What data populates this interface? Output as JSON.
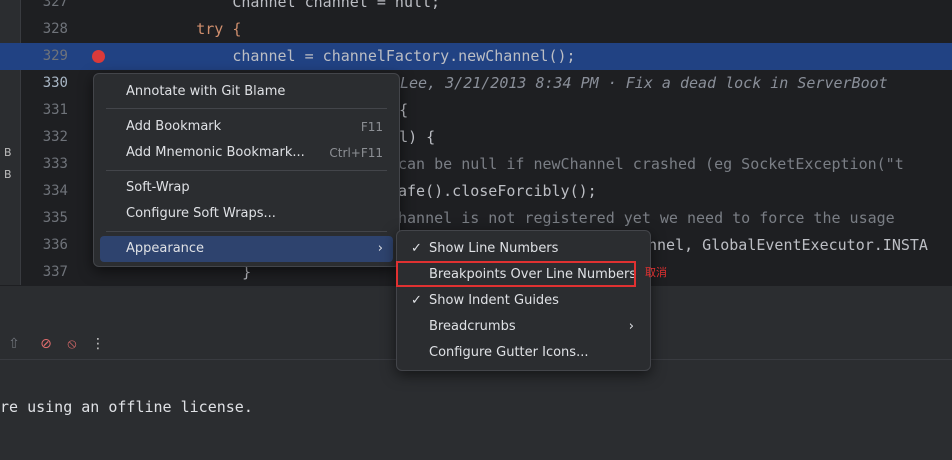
{
  "editor": {
    "lines": [
      {
        "num": "327",
        "code": "            Channel channel = null;"
      },
      {
        "num": "328",
        "code": "        try {"
      },
      {
        "num": "329",
        "code": "            channel = channelFactory.newChannel();"
      },
      {
        "num": "330",
        "code": ""
      },
      {
        "num": "331",
        "code": "t) {"
      },
      {
        "num": "332",
        "code": "null) {"
      },
      {
        "num": "333",
        "code": "can be null if newChannel crashed (eg SocketException(\"t"
      },
      {
        "num": "334",
        "code": "afe().closeForcibly();"
      },
      {
        "num": "335",
        "code": "hannel is not registered yet we need to force the usage"
      },
      {
        "num": "336",
        "code": "nnel, GlobalEventExecutor.INSTA"
      },
      {
        "num": "337",
        "code": "    }"
      }
    ],
    "blame": "Lee, 3/21/2013 8:34 PM · Fix a dead lock in ServerBoot",
    "left_strip": [
      "B",
      "B"
    ]
  },
  "console": {
    "text": "re using an offline license."
  },
  "context_menu": {
    "items": [
      {
        "label": "Annotate with Git Blame",
        "shortcut": ""
      },
      {
        "label": "Add Bookmark",
        "shortcut": "F11"
      },
      {
        "label": "Add Mnemonic Bookmark...",
        "shortcut": "Ctrl+F11"
      },
      {
        "label": "Soft-Wrap",
        "shortcut": ""
      },
      {
        "label": "Configure Soft Wraps...",
        "shortcut": ""
      },
      {
        "label": "Appearance",
        "shortcut": ""
      }
    ]
  },
  "submenu": {
    "items": [
      {
        "label": "Show Line Numbers",
        "checked": "✓"
      },
      {
        "label": "Breakpoints Over Line Numbers",
        "checked": ""
      },
      {
        "label": "Show Indent Guides",
        "checked": "✓"
      },
      {
        "label": "Breadcrumbs",
        "checked": ""
      },
      {
        "label": "Configure Gutter Icons...",
        "checked": ""
      }
    ]
  },
  "annotation": {
    "note": "取消"
  },
  "colors": {
    "highlight": "#214283",
    "menu_selected": "#2e436e",
    "annotation_red": "#e03131",
    "breakpoint": "#db3a3a"
  }
}
